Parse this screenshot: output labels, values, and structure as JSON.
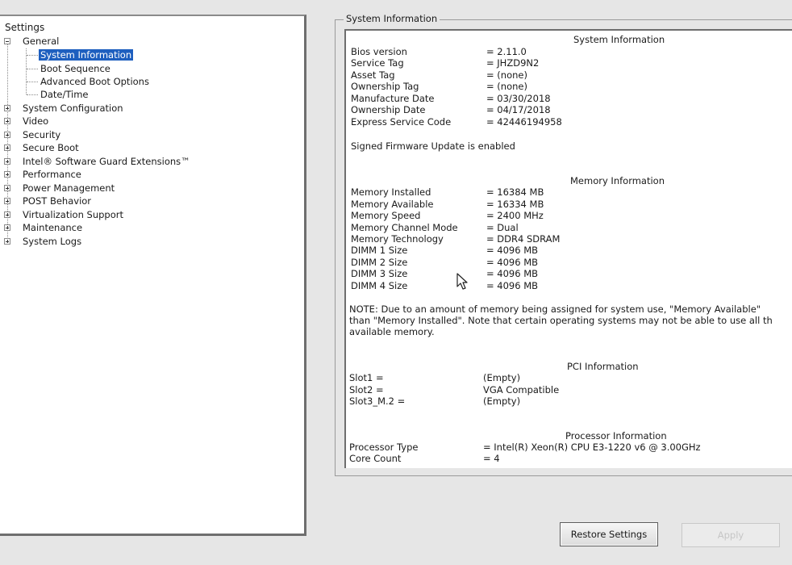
{
  "tree": {
    "root": "Settings",
    "nodes": [
      {
        "label": "General",
        "expanded": true,
        "children": [
          {
            "label": "System Information",
            "selected": true
          },
          {
            "label": "Boot Sequence"
          },
          {
            "label": "Advanced Boot Options"
          },
          {
            "label": "Date/Time"
          }
        ]
      },
      {
        "label": "System Configuration"
      },
      {
        "label": "Video"
      },
      {
        "label": "Security"
      },
      {
        "label": "Secure Boot"
      },
      {
        "label": "Intel® Software Guard Extensions™"
      },
      {
        "label": "Performance"
      },
      {
        "label": "Power Management"
      },
      {
        "label": "POST Behavior"
      },
      {
        "label": "Virtualization Support"
      },
      {
        "label": "Maintenance"
      },
      {
        "label": "System Logs"
      }
    ]
  },
  "content": {
    "group_title": "System Information",
    "system": {
      "title": "System Information",
      "rows": [
        {
          "key": "Bios version",
          "value": "= 2.11.0"
        },
        {
          "key": "Service Tag",
          "value": "= JHZD9N2"
        },
        {
          "key": "Asset Tag",
          "value": "= (none)"
        },
        {
          "key": "Ownership Tag",
          "value": "= (none)"
        },
        {
          "key": "Manufacture Date",
          "value": "= 03/30/2018"
        },
        {
          "key": "Ownership Date",
          "value": "= 04/17/2018"
        },
        {
          "key": "Express Service Code",
          "value": "= 42446194958"
        }
      ],
      "signed_firmware": "Signed Firmware Update is enabled"
    },
    "memory": {
      "title": "Memory Information",
      "rows": [
        {
          "key": "Memory Installed",
          "value": "= 16384 MB"
        },
        {
          "key": "Memory Available",
          "value": "= 16334 MB"
        },
        {
          "key": "Memory Speed",
          "value": "= 2400 MHz"
        },
        {
          "key": "Memory Channel Mode",
          "value": "= Dual"
        },
        {
          "key": "Memory Technology",
          "value": "= DDR4 SDRAM"
        },
        {
          "key": "DIMM 1 Size",
          "value": "= 4096 MB"
        },
        {
          "key": "DIMM 2 Size",
          "value": "= 4096 MB"
        },
        {
          "key": "DIMM 3 Size",
          "value": "= 4096 MB"
        },
        {
          "key": "DIMM 4 Size",
          "value": "= 4096 MB"
        }
      ],
      "note_lines": [
        "NOTE: Due to an amount of memory being assigned for system use, \"Memory Available\"",
        "than \"Memory Installed\". Note that certain operating systems may not be able to use all th",
        "available memory."
      ]
    },
    "pci": {
      "title": "PCI Information",
      "rows": [
        {
          "key": "Slot1 =",
          "value": "(Empty)"
        },
        {
          "key": "Slot2 =",
          "value": "VGA Compatible"
        },
        {
          "key": "Slot3_M.2 =",
          "value": "(Empty)"
        }
      ]
    },
    "processor": {
      "title": "Processor Information",
      "rows": [
        {
          "key": "Processor Type",
          "value": "= Intel(R) Xeon(R) CPU E3-1220 v6 @ 3.00GHz"
        },
        {
          "key": "Core Count",
          "value": "= 4"
        }
      ]
    }
  },
  "buttons": {
    "restore": "Restore Settings",
    "apply": "Apply"
  },
  "colors": {
    "selection": "#1e5fbf",
    "panel_background": "#ffffff",
    "screen_background": "#e6e6e6"
  },
  "icons": {
    "expander_collapsed": "plus-box-icon",
    "expander_expanded": "minus-box-icon",
    "cursor": "mouse-pointer-icon"
  }
}
